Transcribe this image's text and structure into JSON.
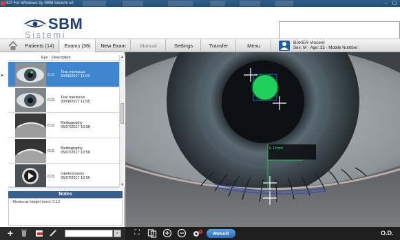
{
  "window": {
    "title": "ICP For Windows by SBM Sistemi srl",
    "min_icon": "minimize-icon",
    "max_icon": "maximize-icon"
  },
  "logo": {
    "brand": "SBM",
    "tagline": "Sistemi"
  },
  "nav": {
    "tabs": [
      {
        "label": "Patients (14)"
      },
      {
        "label": "Exams (36)"
      },
      {
        "label": "New Exam"
      },
      {
        "label": "Manual"
      },
      {
        "label": "Settings"
      },
      {
        "label": "Transfer"
      },
      {
        "label": "Menu"
      }
    ],
    "home_icon": "home-icon"
  },
  "patient": {
    "name": "BAKER Vincent",
    "info": "Sex: M - Age: 33 - Mobile Number:"
  },
  "exam_list": {
    "headers": {
      "eye": "Eye",
      "description": "Description"
    },
    "rows": [
      {
        "eye": "O.D.",
        "title": "Tear meniscus",
        "date": "30/08/2017 11:09"
      },
      {
        "eye": "O.D.",
        "title": "Tear meniscus",
        "date": "30/08/2017 11:08"
      },
      {
        "eye": "O.D.",
        "title": "Meibography",
        "date": "05/07/2017 10:58"
      },
      {
        "eye": "O.D.",
        "title": "Meibography",
        "date": "05/07/2017 10:58"
      },
      {
        "eye": "O.D.",
        "title": "Interferometry",
        "date": "05/07/2017 10:56"
      }
    ]
  },
  "notes": {
    "title": "Notes",
    "text": "- Meniscus Height (mm): 0.12"
  },
  "viewer": {
    "measurement": "0.12mm"
  },
  "toolbar": {
    "search_value": "",
    "result_label": "Result",
    "eye_label": "O.D."
  },
  "colors": {
    "selected_row": "#3e86cf",
    "notes_header": "#355f8c",
    "brand": "#1d3f7a",
    "marker_green": "#1fd05a"
  }
}
